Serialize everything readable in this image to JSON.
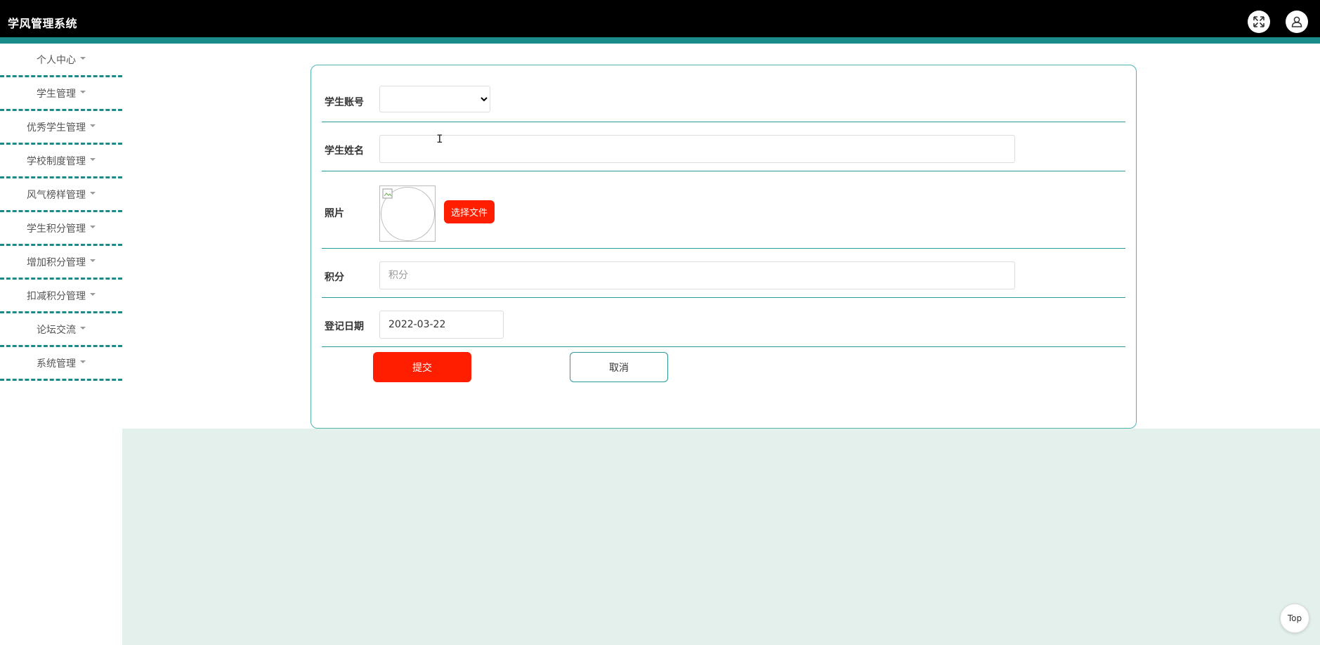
{
  "header": {
    "title": "学风管理系统",
    "fullscreen_icon": "expand-icon",
    "user_icon": "user-icon",
    "background": "#000000",
    "accent": "#1b8a8a"
  },
  "sidebar": {
    "items": [
      {
        "label": "个人中心"
      },
      {
        "label": "学生管理"
      },
      {
        "label": "优秀学生管理"
      },
      {
        "label": "学校制度管理"
      },
      {
        "label": "风气榜样管理"
      },
      {
        "label": "学生积分管理"
      },
      {
        "label": "增加积分管理"
      },
      {
        "label": "扣减积分管理"
      },
      {
        "label": "论坛交流"
      },
      {
        "label": "系统管理"
      }
    ]
  },
  "form": {
    "student_account": {
      "label": "学生账号",
      "value": ""
    },
    "student_name": {
      "label": "学生姓名",
      "value": ""
    },
    "photo": {
      "label": "照片",
      "choose_label": "选择文件"
    },
    "points": {
      "label": "积分",
      "placeholder": "积分",
      "value": ""
    },
    "register_date": {
      "label": "登记日期",
      "value": "2022-03-22"
    },
    "submit_label": "提交",
    "cancel_label": "取消"
  },
  "back_to_top": "Top",
  "colors": {
    "primary_red": "#ff1e00",
    "teal": "#2b9a9a",
    "main_bg": "#e3f0ec"
  }
}
